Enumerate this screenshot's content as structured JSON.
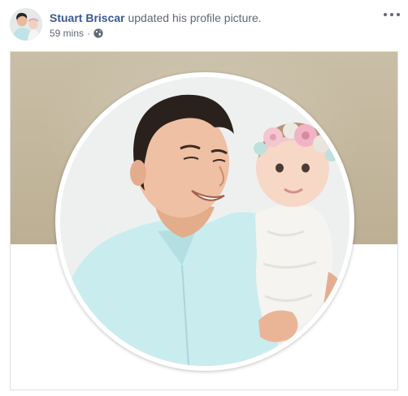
{
  "post": {
    "author": "Stuart Briscar",
    "action": " updated his profile picture.",
    "time": "59 mins",
    "separator": "·",
    "audience_icon": "globe-icon",
    "more_icon": "more-options-icon"
  },
  "media": {
    "type": "profile-picture-update"
  },
  "colors": {
    "author_link": "#385898",
    "secondary_text": "#616770",
    "cover_background": "#c3b79d",
    "border": "#dddfe2"
  }
}
